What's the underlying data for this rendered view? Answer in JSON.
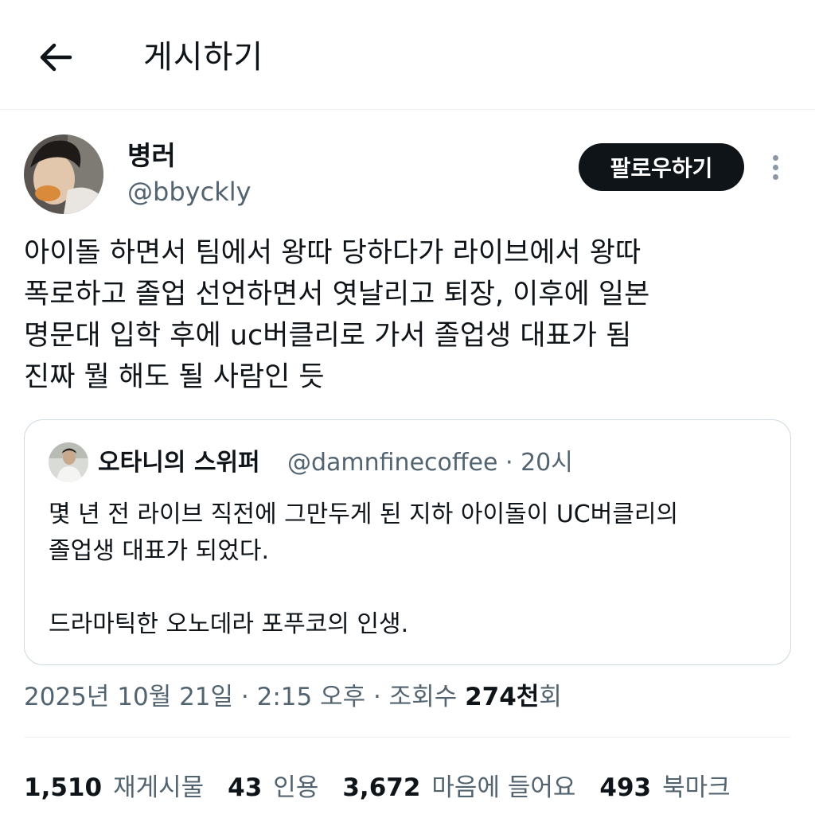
{
  "header": {
    "title": "게시하기",
    "back_icon": "arrow-left-icon"
  },
  "author": {
    "display_name": "병러",
    "handle": "@bbyckly",
    "follow_label": "팔로우하기",
    "more_icon": "more-vertical-icon"
  },
  "tweet": {
    "lines": [
      "아이돌 하면서 팀에서 왕따 당하다가 라이브에서 왕따",
      "폭로하고 졸업 선언하면서 엿날리고 퇴장, 이후에 일본",
      "명문대 입학 후에 uc버클리로 가서 졸업생 대표가 됨",
      "진짜 뭘 해도 될 사람인 듯"
    ]
  },
  "quote": {
    "name": "오타니의 스위퍼",
    "meta": "@damnfinecoffee · 20시",
    "lines": [
      "몇 년 전 라이브 직전에 그만두게 된 지하 아이돌이 UC버클리의",
      "졸업생 대표가 되었다.",
      "드라마틱한 오노데라 포푸코의 인생."
    ]
  },
  "meta": {
    "timestamp": "2025년 10월 21일 · 2:15 오후 · 조회수 ",
    "views_count": "274천",
    "views_suffix": "회"
  },
  "stats": {
    "reposts": {
      "count": "1,510",
      "label": "재게시물"
    },
    "quotes": {
      "count": "43",
      "label": "인용"
    },
    "likes": {
      "count": "3,672",
      "label": "마음에 들어요"
    },
    "bookmarks": {
      "count": "493",
      "label": "북마크"
    }
  },
  "colors": {
    "text": "#0f1419",
    "secondary": "#536471",
    "border": "#cfd9de",
    "follow_bg": "#0f1419"
  }
}
